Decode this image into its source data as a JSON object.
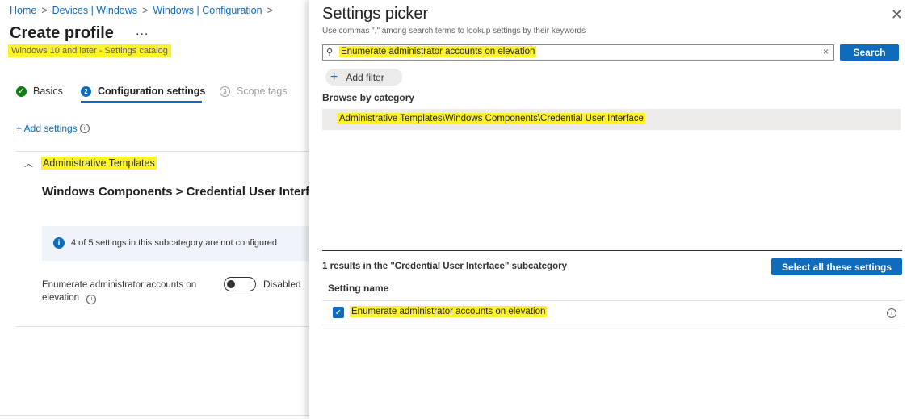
{
  "breadcrumb": {
    "items": [
      "Home",
      "Devices | Windows",
      "Windows | Configuration"
    ],
    "separator": ">"
  },
  "page": {
    "title": "Create profile",
    "more_label": "...",
    "subtitle": "Windows 10 and later - Settings catalog"
  },
  "steps": [
    {
      "label": "Basics",
      "state": "complete"
    },
    {
      "label": "Configuration settings",
      "state": "current",
      "number": "2"
    },
    {
      "label": "Scope tags",
      "state": "upcoming",
      "number": "3"
    }
  ],
  "add_settings_label": "+ Add settings",
  "category": {
    "name": "Administrative Templates",
    "subcategory_title": "Windows Components > Credential User Interface",
    "info_message": "4 of 5 settings in this subcategory are not configured",
    "setting": {
      "label": "Enumerate administrator accounts on elevation",
      "toggle_state": "Disabled"
    }
  },
  "picker": {
    "title": "Settings picker",
    "hint": "Use commas \",\" among search terms to lookup settings by their keywords",
    "search_value": "Enumerate administrator accounts on elevation",
    "search_button": "Search",
    "add_filter_label": "Add filter",
    "browse_label": "Browse by category",
    "category_path": "Administrative Templates\\Windows Components\\Credential User Interface",
    "results_text": "1 results in the \"Credential User Interface\" subcategory",
    "select_all_label": "Select all these settings",
    "column_header": "Setting name",
    "results": [
      {
        "name": "Enumerate administrator accounts on elevation",
        "checked": true
      }
    ]
  },
  "colors": {
    "accent": "#0f6cbd",
    "highlight": "#fcf32a",
    "success": "#107c10"
  },
  "icons": [
    "chevron-right-icon",
    "check-circle-icon",
    "info-icon",
    "chevron-up-icon",
    "close-icon",
    "search-icon",
    "clear-icon",
    "plus-icon",
    "checkbox-checked-icon"
  ]
}
